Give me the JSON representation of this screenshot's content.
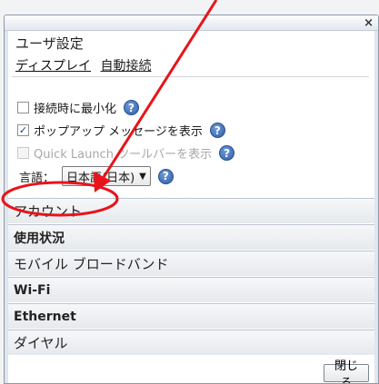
{
  "window": {
    "close_glyph": "×"
  },
  "header": {
    "title": "ユーザ設定"
  },
  "tabs": [
    {
      "label": "ディスプレイ",
      "active": true
    },
    {
      "label": "自動接続",
      "active": false
    }
  ],
  "options": [
    {
      "label": "接続時に最小化",
      "checked": false,
      "disabled": false
    },
    {
      "label": "ポップアップ メッセージを表示",
      "checked": true,
      "disabled": false
    },
    {
      "label": "Quick Launch ツールバーを表示",
      "checked": false,
      "disabled": true
    }
  ],
  "language": {
    "label": "言語：",
    "value": "日本語(日本)"
  },
  "help_glyph": "?",
  "accordion": [
    {
      "label": "アカウント"
    },
    {
      "label": "使用状況"
    },
    {
      "label": "モバイル ブロードバンド"
    },
    {
      "label": "Wi-Fi"
    },
    {
      "label": "Ethernet"
    },
    {
      "label": "ダイヤル"
    }
  ],
  "footer": {
    "close_label": "閉じる"
  },
  "annotation": {
    "color": "#e8141a",
    "target": "アカウント"
  }
}
